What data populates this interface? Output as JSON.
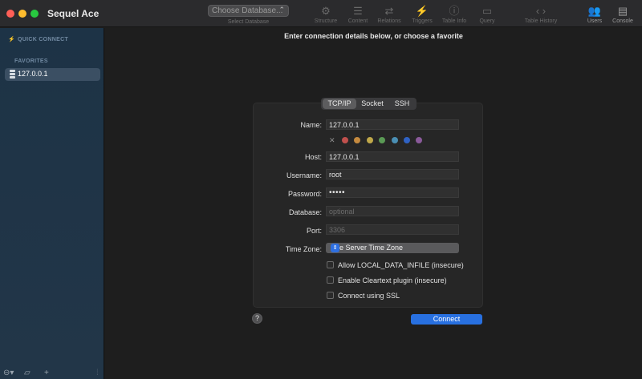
{
  "window": {
    "app_title": "Sequel Ace"
  },
  "toolbar": {
    "database_select": {
      "value": "Choose Database...",
      "caption": "Select Database"
    },
    "tools": [
      {
        "name": "structure",
        "label": "Structure",
        "icon": "structure-icon"
      },
      {
        "name": "content",
        "label": "Content",
        "icon": "content-icon"
      },
      {
        "name": "relations",
        "label": "Relations",
        "icon": "relations-icon"
      },
      {
        "name": "triggers",
        "label": "Triggers",
        "icon": "triggers-icon"
      },
      {
        "name": "table-info",
        "label": "Table Info",
        "icon": "info-icon"
      },
      {
        "name": "query",
        "label": "Query",
        "icon": "query-icon"
      }
    ],
    "table_history": "Table History",
    "users": "Users",
    "console": "Console"
  },
  "sidebar": {
    "quick_connect": "QUICK CONNECT",
    "favorites_heading": "FAVORITES",
    "favorites": [
      {
        "label": "127.0.0.1"
      }
    ]
  },
  "main": {
    "title": "Enter connection details below, or choose a favorite",
    "tabs": [
      {
        "label": "TCP/IP",
        "selected": true
      },
      {
        "label": "Socket",
        "selected": false
      },
      {
        "label": "SSH",
        "selected": false
      }
    ],
    "form": {
      "name_label": "Name:",
      "name_value": "127.0.0.1",
      "host_label": "Host:",
      "host_value": "127.0.0.1",
      "username_label": "Username:",
      "username_value": "root",
      "password_label": "Password:",
      "password_value": "•••••",
      "database_label": "Database:",
      "database_placeholder": "optional",
      "port_label": "Port:",
      "port_placeholder": "3306",
      "timezone_label": "Time Zone:",
      "timezone_value": "Use Server Time Zone"
    },
    "color_swatches": [
      "#c0504d",
      "#c58a3f",
      "#c0a84a",
      "#5a9a55",
      "#4a8fb4",
      "#2f62c4",
      "#8a5a9a",
      "#7a7a7a"
    ],
    "checkboxes": [
      {
        "label": "Allow LOCAL_DATA_INFILE (insecure)",
        "checked": false
      },
      {
        "label": "Enable Cleartext plugin (insecure)",
        "checked": false
      },
      {
        "label": "Connect using SSL",
        "checked": false
      }
    ],
    "help": "?",
    "connect_button": "Connect"
  }
}
